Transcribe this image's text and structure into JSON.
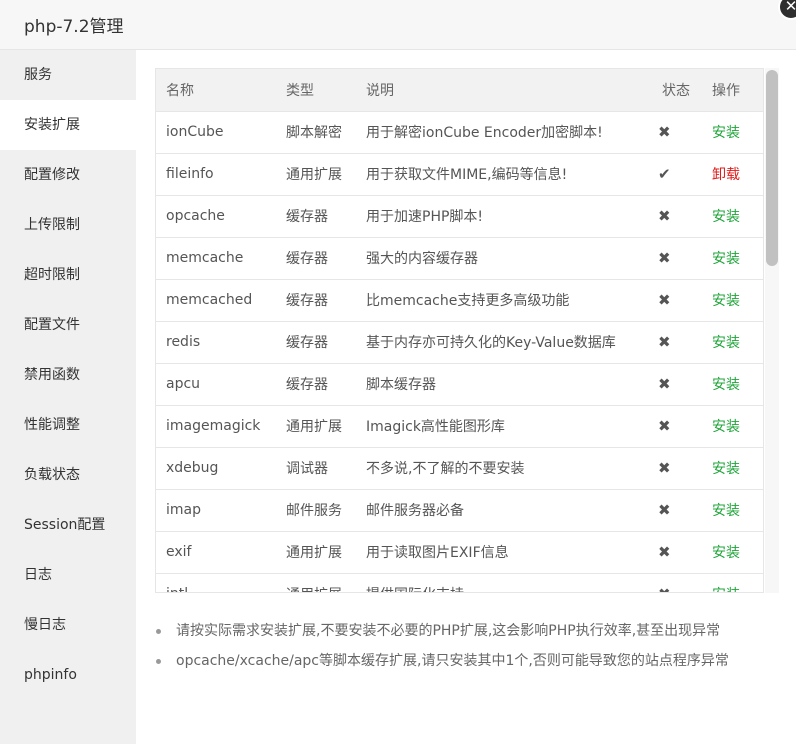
{
  "window": {
    "title": "php-7.2管理",
    "close_icon": "✕"
  },
  "sidebar": {
    "items": [
      {
        "label": "服务"
      },
      {
        "label": "安装扩展",
        "active": true
      },
      {
        "label": "配置修改"
      },
      {
        "label": "上传限制"
      },
      {
        "label": "超时限制"
      },
      {
        "label": "配置文件"
      },
      {
        "label": "禁用函数"
      },
      {
        "label": "性能调整"
      },
      {
        "label": "负载状态"
      },
      {
        "label": "Session配置"
      },
      {
        "label": "日志"
      },
      {
        "label": "慢日志"
      },
      {
        "label": "phpinfo"
      }
    ]
  },
  "table": {
    "headers": {
      "name": "名称",
      "type": "类型",
      "desc": "说明",
      "status": "状态",
      "op": "操作"
    },
    "rows": [
      {
        "name": "ionCube",
        "type": "脚本解密",
        "desc": "用于解密ionCube Encoder加密脚本!",
        "status": "✖",
        "op": "安装"
      },
      {
        "name": "fileinfo",
        "type": "通用扩展",
        "desc": "用于获取文件MIME,编码等信息!",
        "status": "✔",
        "op": "卸载"
      },
      {
        "name": "opcache",
        "type": "缓存器",
        "desc": "用于加速PHP脚本!",
        "status": "✖",
        "op": "安装"
      },
      {
        "name": "memcache",
        "type": "缓存器",
        "desc": "强大的内容缓存器",
        "status": "✖",
        "op": "安装"
      },
      {
        "name": "memcached",
        "type": "缓存器",
        "desc": "比memcache支持更多高级功能",
        "status": "✖",
        "op": "安装"
      },
      {
        "name": "redis",
        "type": "缓存器",
        "desc": "基于内存亦可持久化的Key-Value数据库",
        "status": "✖",
        "op": "安装"
      },
      {
        "name": "apcu",
        "type": "缓存器",
        "desc": "脚本缓存器",
        "status": "✖",
        "op": "安装"
      },
      {
        "name": "imagemagick",
        "type": "通用扩展",
        "desc": "Imagick高性能图形库",
        "status": "✖",
        "op": "安装"
      },
      {
        "name": "xdebug",
        "type": "调试器",
        "desc": "不多说,不了解的不要安装",
        "status": "✖",
        "op": "安装"
      },
      {
        "name": "imap",
        "type": "邮件服务",
        "desc": "邮件服务器必备",
        "status": "✖",
        "op": "安装"
      },
      {
        "name": "exif",
        "type": "通用扩展",
        "desc": "用于读取图片EXIF信息",
        "status": "✖",
        "op": "安装"
      },
      {
        "name": "intl",
        "type": "通用扩展",
        "desc": "提供国际化支持",
        "status": "✖",
        "op": "安装"
      }
    ]
  },
  "notes": [
    "请按实际需求安装扩展,不要安装不必要的PHP扩展,这会影响PHP执行效率,甚至出现异常",
    "opcache/xcache/apc等脚本缓存扩展,请只安装其中1个,否则可能导致您的站点程序异常"
  ],
  "colors": {
    "install": "#20a53a",
    "uninstall": "#e01c1c"
  }
}
